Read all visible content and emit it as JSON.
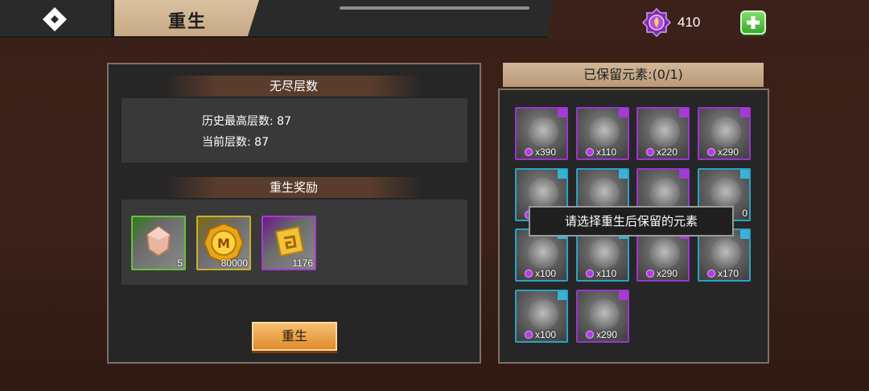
{
  "header": {
    "title": "重生",
    "currency_value": "410",
    "back_icon": "back-arrow-icon",
    "currency_icon": "purple-gem-icon",
    "add_icon": "plus-icon"
  },
  "left_panel": {
    "endless_section_title": "无尽层数",
    "highest_floor_label": "历史最高层数: 87",
    "current_floor_label": "当前层数: 87",
    "reward_section_title": "重生奖励",
    "rewards": [
      {
        "icon": "bronze-crystal-icon",
        "count": "5",
        "rarity": "green"
      },
      {
        "icon": "gold-coin-icon",
        "count": "80000",
        "rarity": "gold"
      },
      {
        "icon": "gold-scroll-icon",
        "count": "1176",
        "rarity": "purple"
      }
    ],
    "rebirth_button_label": "重生"
  },
  "right_panel": {
    "title": "已保留元素:(0/1)",
    "tooltip": "请选择重生后保留的元素",
    "elements": [
      {
        "count": "x390",
        "rarity": "purple"
      },
      {
        "count": "x110",
        "rarity": "purple"
      },
      {
        "count": "x220",
        "rarity": "purple"
      },
      {
        "count": "x290",
        "rarity": "purple"
      },
      {
        "count": "",
        "rarity": "blue"
      },
      {
        "count": "",
        "rarity": "blue"
      },
      {
        "count": "",
        "rarity": "purple"
      },
      {
        "count": "0",
        "rarity": "blue"
      },
      {
        "count": "x100",
        "rarity": "blue"
      },
      {
        "count": "x110",
        "rarity": "blue"
      },
      {
        "count": "x290",
        "rarity": "purple"
      },
      {
        "count": "x170",
        "rarity": "blue"
      },
      {
        "count": "x100",
        "rarity": "blue"
      },
      {
        "count": "x290",
        "rarity": "purple"
      }
    ]
  },
  "colors": {
    "accent": "#d9c1a0",
    "button": "#e08a2c",
    "rarity_purple": "#a63bd4",
    "rarity_blue": "#2aa2c7"
  }
}
